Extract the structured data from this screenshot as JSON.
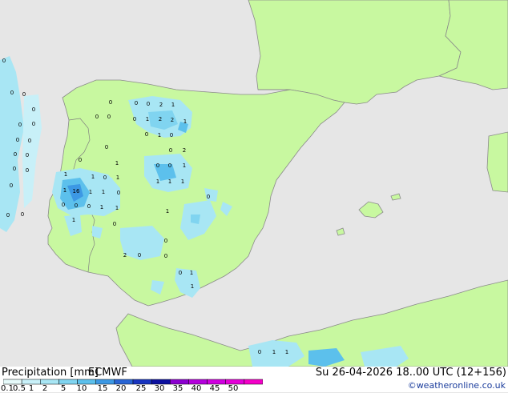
{
  "footer": {
    "title": "Precipitation [mm]",
    "model": "ECMWF",
    "valid_time": "Su 26-04-2026 18..00 UTC (12+156)",
    "credit": "©weatheronline.co.uk"
  },
  "legend": {
    "labels": [
      "0.1",
      "0.5",
      "1",
      "2",
      "5",
      "10",
      "15",
      "20",
      "25",
      "30",
      "35",
      "40",
      "45",
      "50"
    ],
    "colors": [
      "#e6fafa",
      "#c8f0f8",
      "#a8e6f4",
      "#80d4f0",
      "#5cc0ec",
      "#3c98e4",
      "#2864d4",
      "#1834c0",
      "#0c10a0",
      "#8c00d0",
      "#b400dc",
      "#d000e0",
      "#e400d8",
      "#f400c8"
    ]
  },
  "map": {
    "colors": {
      "sea": "#e6e6e6",
      "land": "#c8f8a0",
      "border": "#808080",
      "coast": "#8a8a8a"
    },
    "values": [
      {
        "v": "0"
      },
      {
        "v": "0"
      },
      {
        "v": "0"
      },
      {
        "v": "2"
      },
      {
        "v": "1"
      },
      {
        "v": "0"
      },
      {
        "v": "0"
      },
      {
        "v": "0"
      },
      {
        "v": "1"
      },
      {
        "v": "2"
      },
      {
        "v": "2"
      },
      {
        "v": "1"
      },
      {
        "v": "0"
      },
      {
        "v": "1"
      },
      {
        "v": "0"
      },
      {
        "v": "0"
      },
      {
        "v": "2"
      },
      {
        "v": "0"
      },
      {
        "v": "0"
      },
      {
        "v": "1"
      },
      {
        "v": "1"
      },
      {
        "v": "1"
      },
      {
        "v": "1"
      },
      {
        "v": "1"
      },
      {
        "v": "0"
      },
      {
        "v": "0"
      },
      {
        "v": "1"
      },
      {
        "v": "1"
      },
      {
        "v": "0"
      },
      {
        "v": "1"
      },
      {
        "v": "16"
      },
      {
        "v": "1"
      },
      {
        "v": "1"
      },
      {
        "v": "1"
      },
      {
        "v": "0"
      },
      {
        "v": "0"
      },
      {
        "v": "0"
      },
      {
        "v": "0"
      },
      {
        "v": "1"
      },
      {
        "v": "1"
      },
      {
        "v": "1"
      },
      {
        "v": "0"
      },
      {
        "v": "0"
      },
      {
        "v": "2"
      },
      {
        "v": "0"
      },
      {
        "v": "0"
      },
      {
        "v": "0"
      },
      {
        "v": "1"
      },
      {
        "v": "0"
      },
      {
        "v": "1"
      },
      {
        "v": "1"
      },
      {
        "v": "0"
      },
      {
        "v": "0"
      },
      {
        "v": "0"
      },
      {
        "v": "0"
      },
      {
        "v": "0"
      },
      {
        "v": "0"
      },
      {
        "v": "0"
      },
      {
        "v": "0"
      },
      {
        "v": "0"
      },
      {
        "v": "0"
      },
      {
        "v": "0"
      },
      {
        "v": "0"
      },
      {
        "v": "0"
      },
      {
        "v": "0"
      },
      {
        "v": "0"
      }
    ]
  }
}
